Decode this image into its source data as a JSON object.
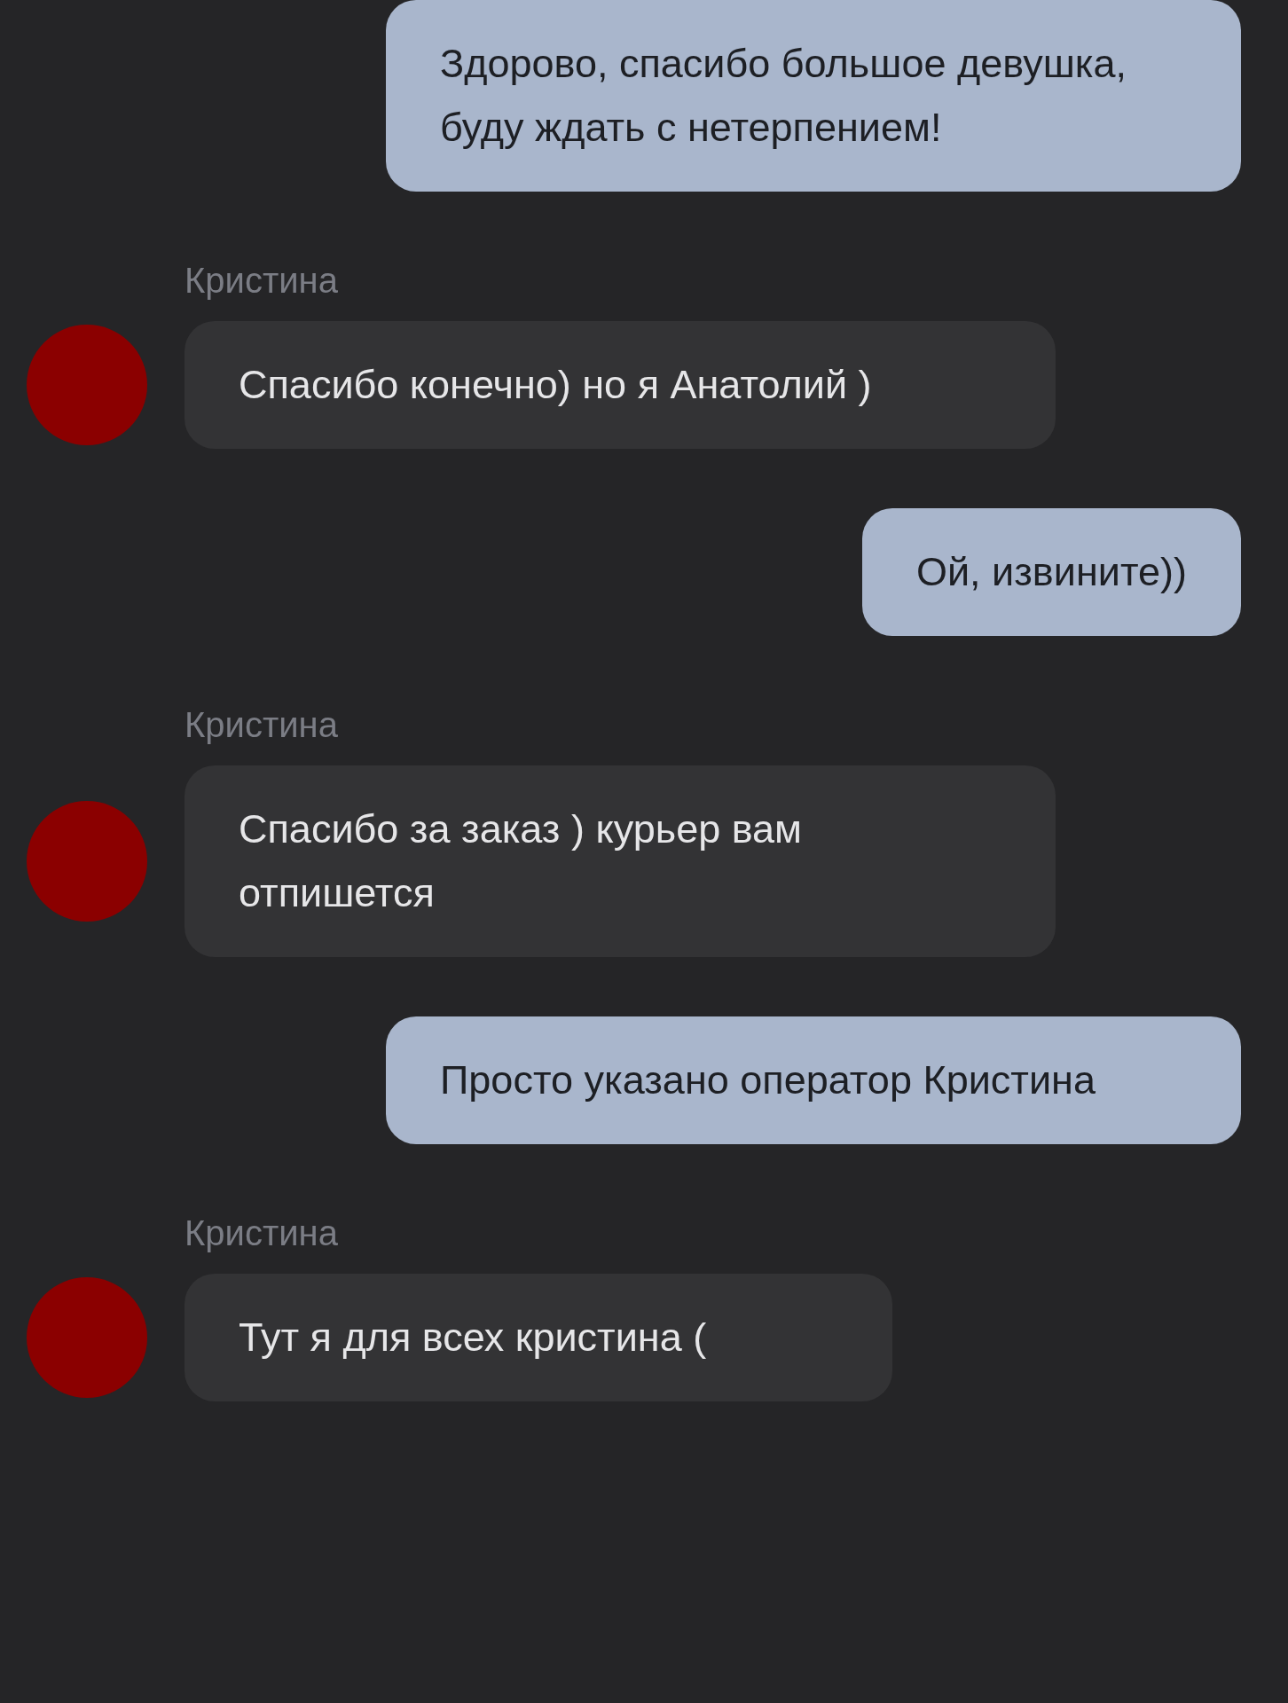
{
  "messages": [
    {
      "kind": "outgoing",
      "text": "Здорово, спасибо большое девушка, буду ждать с нетерпением!"
    },
    {
      "kind": "incoming",
      "sender": "Кристина",
      "text": "Спасибо конечно) но я Анатолий )"
    },
    {
      "kind": "outgoing",
      "text": "Ой, извините))"
    },
    {
      "kind": "incoming",
      "sender": "Кристина",
      "text": "Спасибо за заказ ) курьер вам отпишется"
    },
    {
      "kind": "outgoing",
      "text": "Просто указано оператор Кристина"
    },
    {
      "kind": "incoming",
      "sender": "Кристина",
      "text": "Тут я для всех кристина ("
    }
  ]
}
